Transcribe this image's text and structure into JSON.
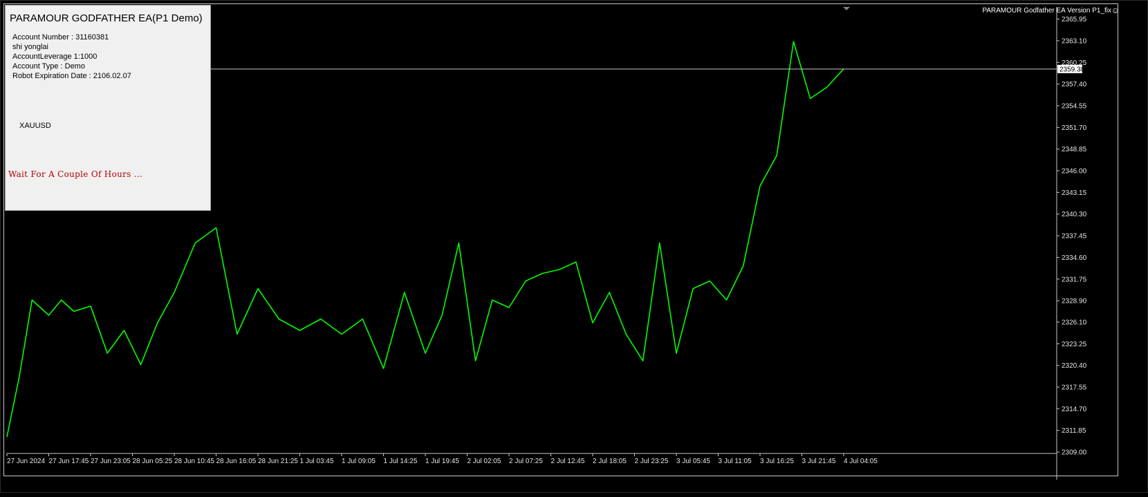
{
  "panel": {
    "title": "PARAMOUR GODFATHER EA(P1 Demo)",
    "account_number": "Account Number : 31160381",
    "user_name": "shi yonglai",
    "leverage": "AccountLeverage 1:1000",
    "account_type": "Account Type : Demo",
    "expiration": "Robot Expiration Date : 2106.02.07",
    "symbol": "XAUUSD",
    "message": "Wait For A Couple Of Hours ..."
  },
  "version_label": "PARAMOUR Godfather EA  Version P1_fix",
  "version_icon": "smiley-icon",
  "current_price": "2359.38",
  "colors": {
    "series": "#00ff00",
    "background": "#000000",
    "message": "#b30000"
  },
  "chart_data": {
    "type": "line",
    "title": "",
    "xlabel": "",
    "ylabel": "",
    "ylim": [
      2309.0,
      2367.0
    ],
    "y_ticks": [
      "2365.95",
      "2363.10",
      "2360.25",
      "2357.40",
      "2354.55",
      "2351.70",
      "2348.85",
      "2346.00",
      "2343.15",
      "2340.30",
      "2337.45",
      "2334.60",
      "2331.75",
      "2328.90",
      "2326.10",
      "2323.25",
      "2320.40",
      "2317.55",
      "2314.70",
      "2311.85",
      "2309.00"
    ],
    "x_ticks": [
      "27 Jun 2024",
      "27 Jun 17:45",
      "27 Jun 23:05",
      "28 Jun 05:25",
      "28 Jun 10:45",
      "28 Jun 16:05",
      "28 Jun 21:25",
      "1 Jul 03:45",
      "1 Jul 09:05",
      "1 Jul 14:25",
      "1 Jul 19:45",
      "2 Jul 02:05",
      "2 Jul 07:25",
      "2 Jul 12:45",
      "2 Jul 18:05",
      "2 Jul 23:25",
      "3 Jul 05:45",
      "3 Jul 11:05",
      "3 Jul 16:25",
      "3 Jul 21:45",
      "4 Jul 04:05"
    ],
    "grid": false,
    "series": [
      {
        "x": [
          0,
          0.3,
          0.6,
          1.0,
          1.3,
          1.6,
          2.0,
          2.4,
          2.8,
          3.2,
          3.6,
          4.0,
          4.5,
          5.0,
          5.5,
          6.0,
          6.5,
          7.0,
          7.5,
          8.0,
          8.5,
          9.0,
          9.5,
          10.0,
          10.4,
          10.8,
          11.2,
          11.6,
          12.0,
          12.4,
          12.8,
          13.2,
          13.6,
          14.0,
          14.4,
          14.8,
          15.2,
          15.6,
          16.0,
          16.4,
          16.8,
          17.2,
          17.6,
          18.0,
          18.4,
          18.8,
          19.2,
          19.6,
          20.0
        ],
        "values": [
          2311.0,
          2319.0,
          2329.0,
          2327.0,
          2329.0,
          2327.5,
          2328.2,
          2322.0,
          2325.0,
          2320.5,
          2326.0,
          2330.0,
          2336.5,
          2338.5,
          2324.5,
          2330.5,
          2326.5,
          2325.0,
          2326.5,
          2324.5,
          2326.5,
          2320.0,
          2330.0,
          2322.0,
          2327.0,
          2336.5,
          2321.0,
          2329.0,
          2328.0,
          2331.5,
          2332.5,
          2333.0,
          2334.0,
          2326.0,
          2330.0,
          2324.5,
          2321.0,
          2336.5,
          2322.0,
          2330.5,
          2331.5,
          2329.0,
          2333.5,
          2344.0,
          2348.0,
          2363.0,
          2355.5,
          2357.0,
          2359.4
        ]
      }
    ]
  }
}
